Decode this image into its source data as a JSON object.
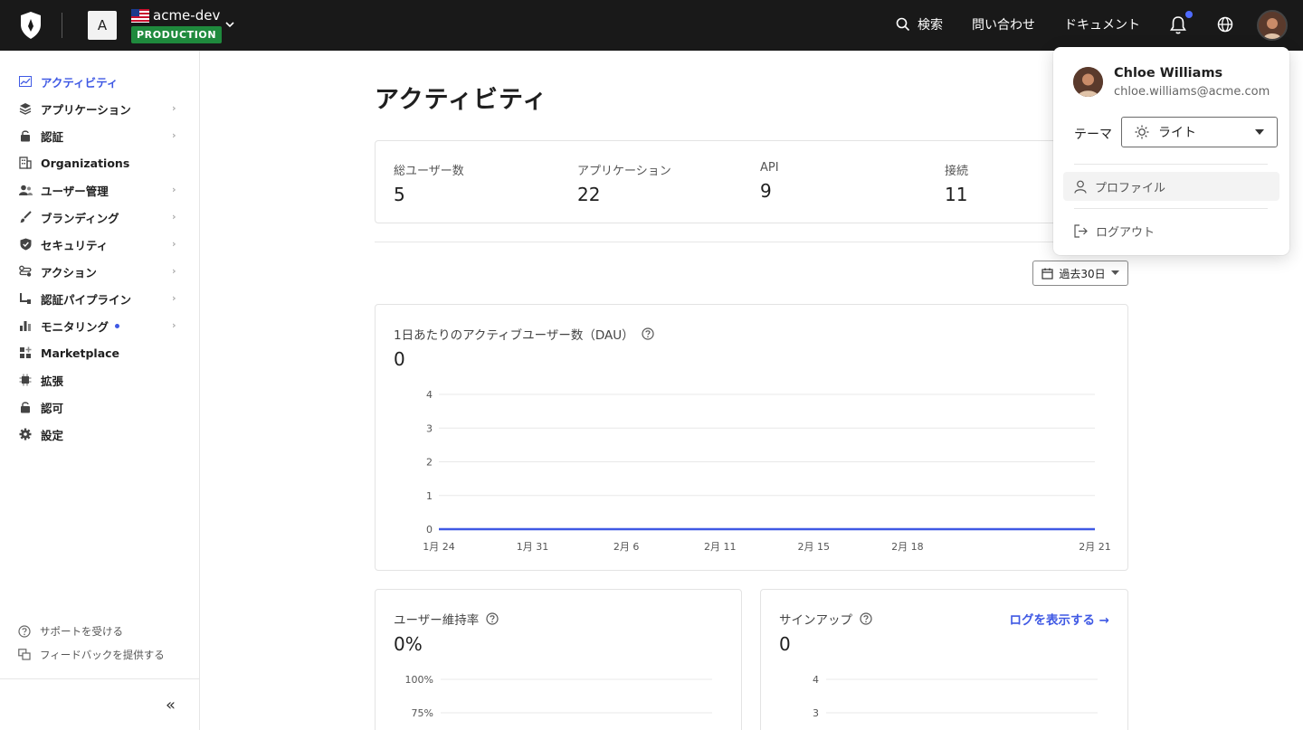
{
  "topbar": {
    "tenant_initial": "A",
    "tenant_name": "acme-dev",
    "environment": "PRODUCTION",
    "search_label": "検索",
    "contact_label": "問い合わせ",
    "docs_label": "ドキュメント",
    "colors": {
      "background": "#191919",
      "badge": "#1f8a3d",
      "notification_dot": "#4f6bff"
    }
  },
  "sidebar": {
    "items": [
      {
        "label": "アクティビティ",
        "icon": "activity-icon",
        "active": true
      },
      {
        "label": "アプリケーション",
        "icon": "layers-icon",
        "chevron": true
      },
      {
        "label": "認証",
        "icon": "lock-icon",
        "chevron": true
      },
      {
        "label": "Organizations",
        "icon": "building-icon"
      },
      {
        "label": "ユーザー管理",
        "icon": "users-icon",
        "chevron": true
      },
      {
        "label": "ブランディング",
        "icon": "brush-icon",
        "chevron": true
      },
      {
        "label": "セキュリティ",
        "icon": "shield-icon",
        "chevron": true
      },
      {
        "label": "アクション",
        "icon": "actions-icon",
        "chevron": true
      },
      {
        "label": "認証パイプライン",
        "icon": "pipeline-icon",
        "chevron": true
      },
      {
        "label": "モニタリング",
        "icon": "bar-chart-icon",
        "chevron": true,
        "dot": true
      },
      {
        "label": "Marketplace",
        "icon": "grid-plus-icon"
      },
      {
        "label": "拡張",
        "icon": "chip-icon"
      },
      {
        "label": "認可",
        "icon": "lock-icon"
      },
      {
        "label": "設定",
        "icon": "gear-icon"
      }
    ],
    "support_label": "サポートを受ける",
    "feedback_label": "フィードバックを提供する",
    "active_color": "#3f59e4"
  },
  "main": {
    "title": "アクティビティ",
    "stats": [
      {
        "label": "総ユーザー数",
        "value": "5"
      },
      {
        "label": "アプリケーション",
        "value": "22"
      },
      {
        "label": "API",
        "value": "9"
      },
      {
        "label": "接続",
        "value": "11"
      }
    ],
    "date_range": "過去30日",
    "dau": {
      "title": "1日あたりのアクティブユーザー数（DAU）",
      "value": "0"
    },
    "retention": {
      "title": "ユーザー維持率",
      "value": "0%"
    },
    "signups": {
      "title": "サインアップ",
      "value": "0",
      "view_logs": "ログを表示する →"
    }
  },
  "chart_data": [
    {
      "type": "line",
      "x_ticks": [
        "1月 24",
        "1月 31",
        "2月 6",
        "2月 11",
        "2月 15",
        "2月 18",
        "2月 21"
      ],
      "y_ticks": [
        "0",
        "1",
        "2",
        "3",
        "4"
      ],
      "ylim": [
        0,
        4
      ],
      "series": [
        {
          "values": [
            0,
            0,
            0,
            0,
            0,
            0,
            0
          ],
          "color": "#3f59e4"
        }
      ],
      "grid": true
    },
    {
      "type": "line",
      "y_ticks": [
        "75%",
        "100%"
      ],
      "grid": true
    },
    {
      "type": "line",
      "y_ticks": [
        "3",
        "4"
      ],
      "grid": true
    }
  ],
  "user_menu": {
    "name": "Chloe Williams",
    "email": "chloe.williams@acme.com",
    "theme_label": "テーマ",
    "theme_value": "ライト",
    "profile_label": "プロファイル",
    "logout_label": "ログアウト"
  }
}
